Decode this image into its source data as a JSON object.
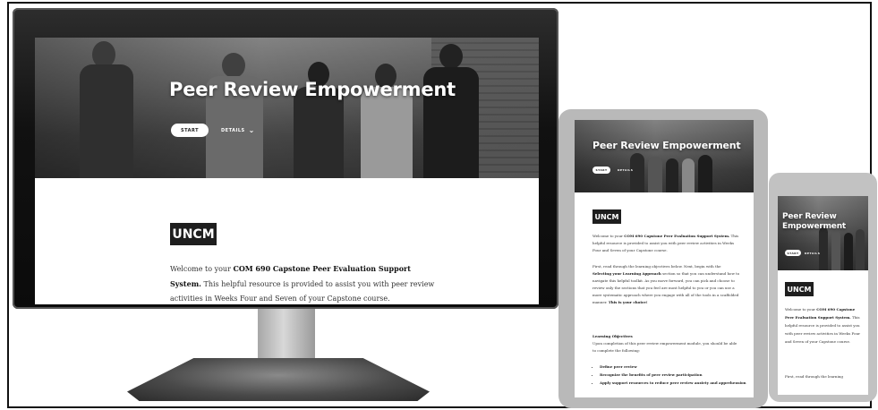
{
  "colors": {
    "accent": "#1e1e1e",
    "hero_text": "#ffffff",
    "device_frame": "#b9b9b9"
  },
  "icons": {
    "details_chevron": "chevron-down-icon"
  },
  "monitor": {
    "hero_title": "Peer Review Empowerment",
    "start_label": "START",
    "details_label": "DETAILS",
    "logo_text": "UNCM",
    "welcome_prefix": "Welcome to your ",
    "welcome_bold": "COM 690 Capstone Peer Evaluation Support System.",
    "welcome_rest": " This helpful resource is provided to assist you with peer review activities in Weeks Four and Seven of your Capstone course."
  },
  "tablet": {
    "hero_title": "Peer Review Empowerment",
    "start_label": "START",
    "details_label": "DETAILS",
    "logo_text": "UNCM",
    "p1_prefix": "Welcome to your ",
    "p1_bold": "COM 690 Capstone Peer Evaluation Support System.",
    "p1_rest": " This helpful resource is provided to assist you with peer review activities in Weeks Four and Seven of your Capstone course.",
    "p2_a": "First, read through the learning objectives below. Next, begin with the ",
    "p2_b": "Selecting your Learning Approach",
    "p2_c": " section so that you can understand how to navigate this helpful toolkit. As you move forward, you can pick and choose to review only the sections that you feel are most helpful to you or you can use a more systematic approach where you engage with all of the tools in a scaffolded manner. ",
    "p2_d": "This is your choice!",
    "objectives_heading": "Learning Objectives",
    "objectives_intro": "Upon completion of this peer review empowerment module, you should be able to complete the following:",
    "objectives": [
      "Define peer review",
      "Recognize the benefits of peer review participation",
      "Apply support resources to reduce peer review anxiety and apprehension"
    ]
  },
  "phone": {
    "hero_title": "Peer Review Empowerment",
    "start_label": "START",
    "details_label": "DETAILS",
    "logo_text": "UNCM",
    "p1_prefix": "Welcome to your ",
    "p1_bold": "COM 690 Capstone Peer Evaluation Support System.",
    "p1_rest": " This helpful resource is provided to assist you with peer review activities in Weeks Four and Seven of your Capstone course.",
    "p2": "First, read through the learning"
  }
}
